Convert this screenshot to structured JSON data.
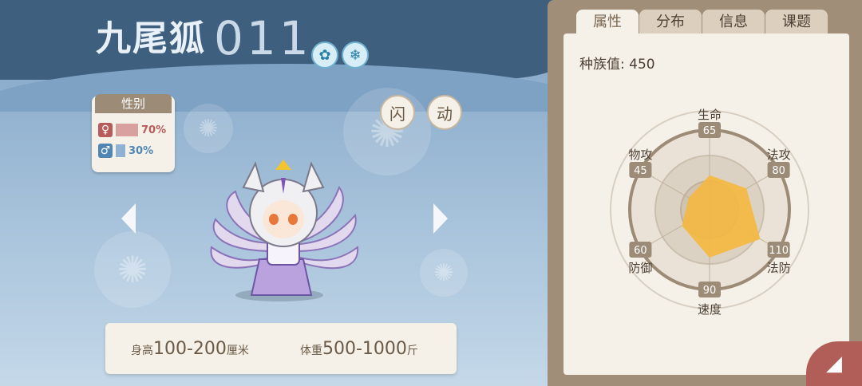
{
  "pokemon": {
    "name": "九尾狐",
    "number": "011",
    "types": [
      {
        "icon": "wind-icon",
        "glyph": "✿"
      },
      {
        "icon": "snowflake-icon",
        "glyph": "❄"
      }
    ]
  },
  "gender": {
    "title": "性别",
    "female": {
      "symbol": "♀",
      "value": "70%",
      "fraction": 0.7,
      "color": "#b85b5b"
    },
    "male": {
      "symbol": "♂",
      "value": "30%",
      "fraction": 0.3,
      "color": "#4f86b4"
    }
  },
  "skills": [
    "闪",
    "动"
  ],
  "info": {
    "height_label": "身高",
    "height_value": "100-200",
    "height_unit": "厘米",
    "weight_label": "体重",
    "weight_value": "500-1000",
    "weight_unit": "斤"
  },
  "tabs": [
    {
      "label": "属性",
      "active": true
    },
    {
      "label": "分布",
      "active": false
    },
    {
      "label": "信息",
      "active": false
    },
    {
      "label": "课题",
      "active": false
    }
  ],
  "stats": {
    "total_label": "种族值:",
    "total_value": "450",
    "max": 150,
    "items": [
      {
        "label": "生命",
        "value": 65
      },
      {
        "label": "法攻",
        "value": 80
      },
      {
        "label": "法防",
        "value": 110
      },
      {
        "label": "速度",
        "value": 90
      },
      {
        "label": "防御",
        "value": 60
      },
      {
        "label": "物攻",
        "value": 45
      }
    ]
  },
  "colors": {
    "accent": "#f4b942",
    "panel": "#f5f1e8",
    "brown": "#9c8b77"
  },
  "corner_button": {
    "icon": "swipe-icon",
    "glyph": "◢"
  }
}
